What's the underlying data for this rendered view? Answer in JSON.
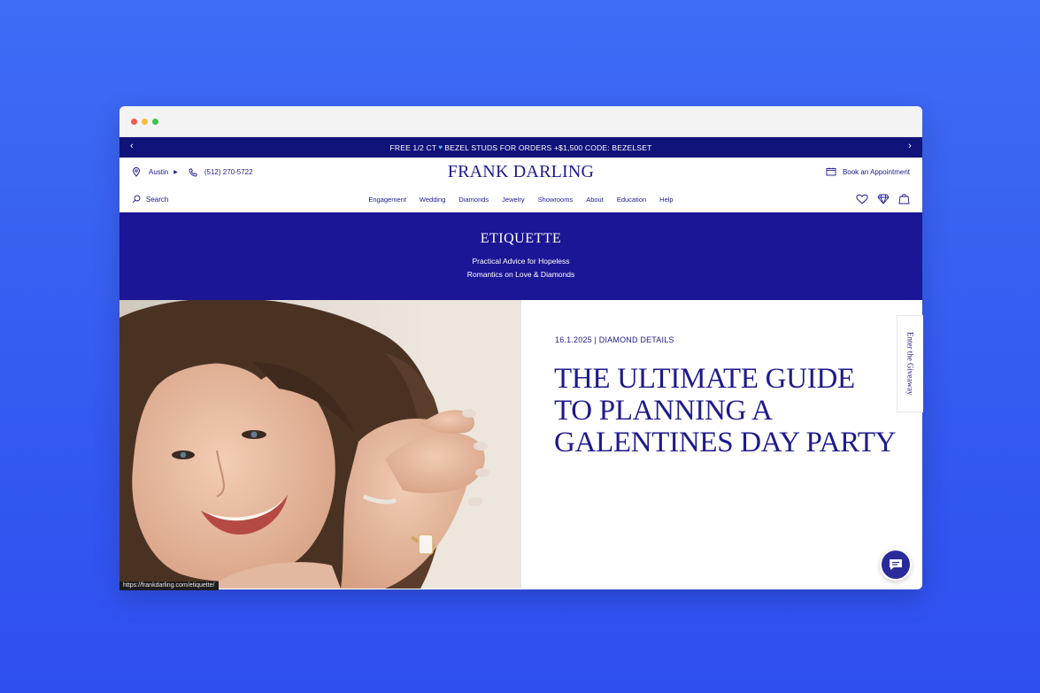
{
  "promo": {
    "text_before": "FREE 1/2 CT",
    "text_after": "BEZEL STUDS FOR ORDERS +$1,500 CODE: BEZELSET",
    "prev": "‹",
    "next": "›"
  },
  "header": {
    "location": "Austin",
    "phone": "(512) 270-5722",
    "logo": "FRANK DARLING",
    "appointment": "Book an Appointment",
    "search": "Search"
  },
  "nav": {
    "items": [
      "Engagement",
      "Wedding",
      "Diamonds",
      "Jewelry",
      "Showrooms",
      "About",
      "Education",
      "Help"
    ]
  },
  "banner": {
    "title": "ETIQUETTE",
    "subtitle_line1": "Practical Advice for Hopeless",
    "subtitle_line2": "Romantics on Love & Diamonds"
  },
  "article": {
    "meta": "16.1.2025 | DIAMOND DETAILS",
    "headline_line1": "THE ULTIMATE GUIDE",
    "headline_line2": "TO PLANNING A",
    "headline_line3": "GALENTINES DAY PARTY"
  },
  "giveaway": {
    "label": "Enter the Giveaway"
  },
  "status_url": "https://frankdarling.com/etiquette/",
  "colors": {
    "brand": "#1d1a8c",
    "banner": "#1b1696",
    "promo": "#11127a",
    "background": "#3e6cf6"
  }
}
